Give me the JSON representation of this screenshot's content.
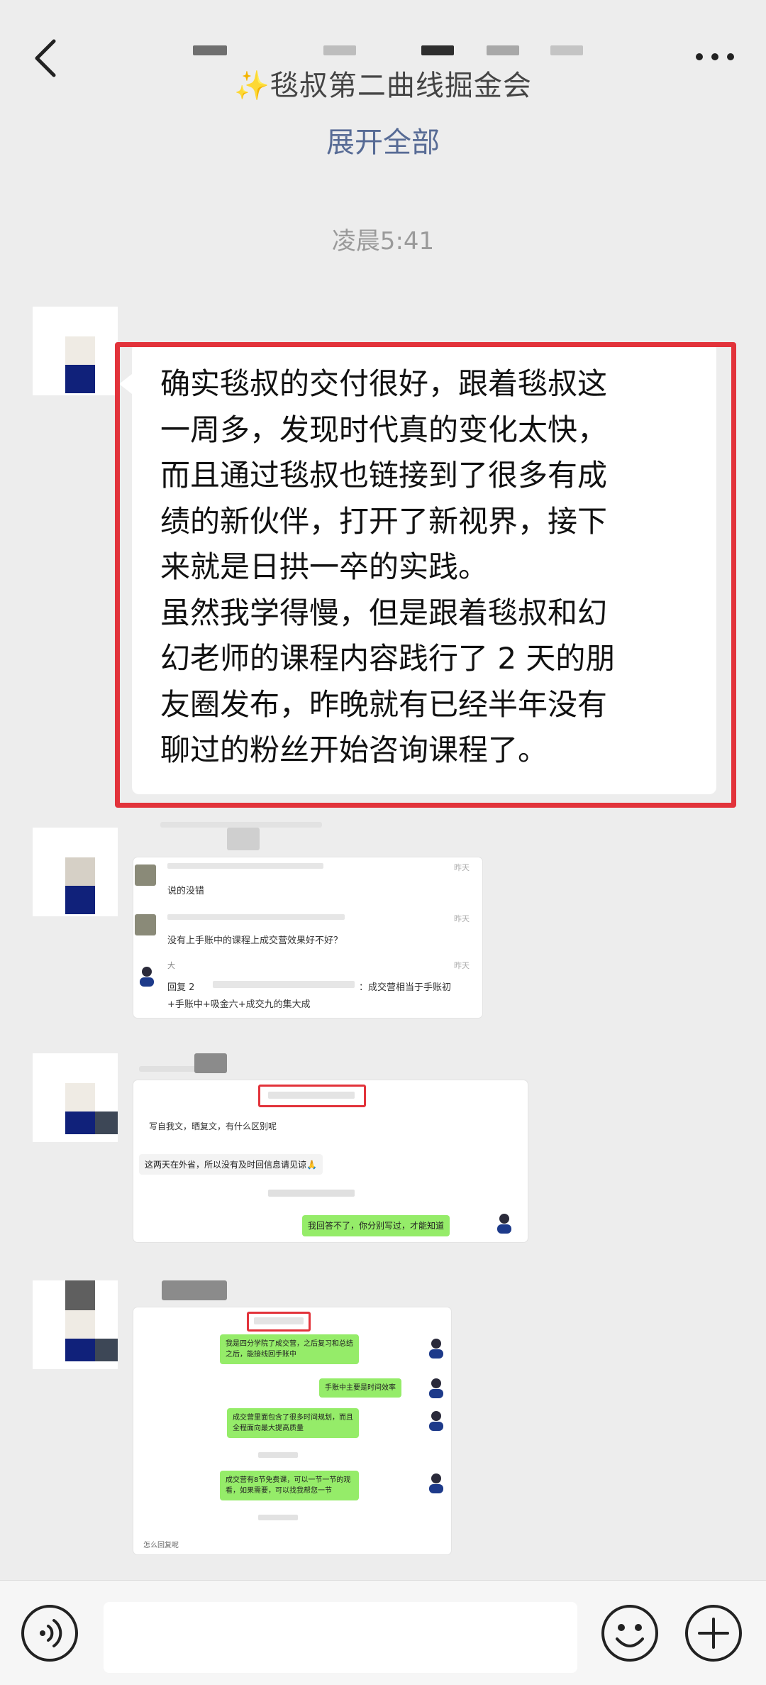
{
  "nav": {
    "title": "✨毯叔第二曲线掘金会"
  },
  "chat": {
    "expand_all": "展开全部",
    "time": "凌晨5:41",
    "main_message": "确实毯叔的交付很好，跟着毯叔这\n一周多，发现时代真的变化太快，\n而且通过毯叔也链接到了很多有成\n绩的新伙伴，打开了新视界，接下\n来就是日拱一卒的实践。\n虽然我学得慢，但是跟着毯叔和幻\n幻老师的课程内容践行了 2 天的朋\n友圈发布，昨晚就有已经半年没有\n聊过的粉丝开始咨询课程了。",
    "card1": {
      "r1_text": "说的没错",
      "r2_text": "没有上手账中的课程上成交营效果好不好？",
      "r3_name": "大",
      "r3_text1": "回复 2",
      "r3_text2": "：成交营相当于手账初",
      "r3_text3": "+手账中+吸金六+成交九的集大成",
      "time_a": "昨天",
      "time_b": "昨天",
      "time_c": "昨天"
    },
    "card2": {
      "q1": "写自我文，晒复文，有什么区别呢",
      "q2": "这两天在外省，所以没有及时回信息请见谅🙏",
      "reply": "我回答不了，你分别写过，才能知道"
    },
    "card3": {
      "m1": "我是四分学院了成交营，之后复习和总结之后，能接线回手账中",
      "m2": "手账中主要是时间效率",
      "m3": "成交营里面包含了很多时间规划，而且全程面向最大提高质量",
      "m4": "成交营有8节免费课，可以一节一节的观看，如果需要，可以找我帮您一节",
      "footer": "怎么回复呢"
    }
  },
  "colors": {
    "nav_bg": "#ededed",
    "link": "#576b95",
    "highlight": "#e2333b",
    "wechat_green": "#95ec69"
  }
}
